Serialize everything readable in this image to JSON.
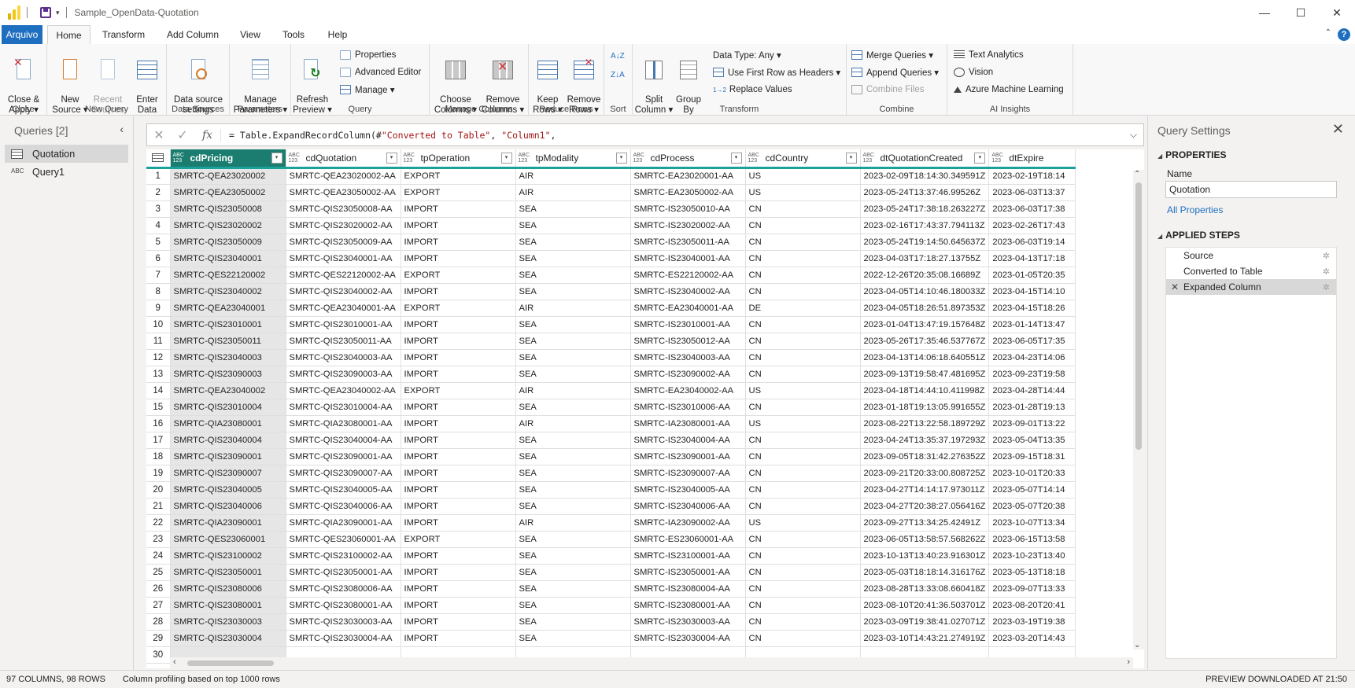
{
  "window": {
    "title": "Sample_OpenData-Quotation",
    "minimize": "—",
    "maximize": "☐",
    "close": "✕"
  },
  "tabs": [
    "Arquivo",
    "Home",
    "Transform",
    "Add Column",
    "View",
    "Tools",
    "Help"
  ],
  "help_glyph": "?",
  "ribbon": {
    "close_group": {
      "label": "Close",
      "close_apply": "Close &\nApply ▾"
    },
    "new_query_group": {
      "label": "New Query",
      "new_source": "New\nSource ▾",
      "recent_sources": "Recent\nSources ▾",
      "enter_data": "Enter\nData"
    },
    "data_sources_group": {
      "label": "Data Sources",
      "data_source_settings": "Data source\nsettings"
    },
    "parameters_group": {
      "label": "Parameters",
      "manage_parameters": "Manage\nParameters ▾"
    },
    "query_group": {
      "label": "Query",
      "refresh_preview": "Refresh\nPreview ▾",
      "properties": "Properties",
      "advanced_editor": "Advanced Editor",
      "manage": "Manage ▾"
    },
    "manage_columns_group": {
      "label": "Manage Columns",
      "choose_columns": "Choose\nColumns ▾",
      "remove_columns": "Remove\nColumns ▾"
    },
    "reduce_rows_group": {
      "label": "Reduce Rows",
      "keep_rows": "Keep\nRows ▾",
      "remove_rows": "Remove\nRows ▾"
    },
    "sort_group": {
      "label": "Sort",
      "az": "A↓Z",
      "za": "Z↓A"
    },
    "transform_group": {
      "label": "Transform",
      "split_column": "Split\nColumn ▾",
      "group_by": "Group\nBy",
      "data_type": "Data Type: Any ▾",
      "use_first_row": "Use First Row as Headers ▾",
      "replace_values": "Replace Values",
      "replace_prefix": "1→2"
    },
    "combine_group": {
      "label": "Combine",
      "merge_queries": "Merge Queries ▾",
      "append_queries": "Append Queries ▾",
      "combine_files": "Combine Files"
    },
    "ai_group": {
      "label": "AI Insights",
      "text_analytics": "Text Analytics",
      "vision": "Vision",
      "azure_ml": "Azure Machine Learning"
    }
  },
  "queries_pane": {
    "title": "Queries [2]",
    "collapse": "‹",
    "items": [
      {
        "label": "Quotation",
        "icon": "table-icon",
        "selected": true
      },
      {
        "label": "Query1",
        "icon": "abc-icon",
        "icon_glyph": "ABC",
        "selected": false
      }
    ]
  },
  "formula_bar": {
    "cancel": "✕",
    "commit": "✓",
    "fx": "fx",
    "prefix": "= Table.ExpandRecordColumn(#",
    "arg1": "\"Converted to Table\"",
    "sep": ", ",
    "arg2": "\"Column1\"",
    "suffix": ",",
    "expand": "⌵"
  },
  "grid": {
    "type_glyph": "ABC 123",
    "columns": [
      {
        "name": "cdPricing",
        "width": 147,
        "selected": true
      },
      {
        "name": "cdQuotation",
        "width": 146
      },
      {
        "name": "tpOperation",
        "width": 146
      },
      {
        "name": "tpModality",
        "width": 146
      },
      {
        "name": "cdProcess",
        "width": 146
      },
      {
        "name": "cdCountry",
        "width": 146
      },
      {
        "name": "dtQuotationCreated",
        "width": 155
      },
      {
        "name": "dtExpire",
        "width": 110
      }
    ],
    "rows": [
      [
        "1",
        "SMRTC-QEA23020002",
        "SMRTC-QEA23020002-AA",
        "EXPORT",
        "AIR",
        "SMRTC-EA23020001-AA",
        "US",
        "2023-02-09T18:14:30.349591Z",
        "2023-02-19T18:14"
      ],
      [
        "2",
        "SMRTC-QEA23050002",
        "SMRTC-QEA23050002-AA",
        "EXPORT",
        "AIR",
        "SMRTC-EA23050002-AA",
        "US",
        "2023-05-24T13:37:46.99526Z",
        "2023-06-03T13:37"
      ],
      [
        "3",
        "SMRTC-QIS23050008",
        "SMRTC-QIS23050008-AA",
        "IMPORT",
        "SEA",
        "SMRTC-IS23050010-AA",
        "CN",
        "2023-05-24T17:38:18.263227Z",
        "2023-06-03T17:38"
      ],
      [
        "4",
        "SMRTC-QIS23020002",
        "SMRTC-QIS23020002-AA",
        "IMPORT",
        "SEA",
        "SMRTC-IS23020002-AA",
        "CN",
        "2023-02-16T17:43:37.794113Z",
        "2023-02-26T17:43"
      ],
      [
        "5",
        "SMRTC-QIS23050009",
        "SMRTC-QIS23050009-AA",
        "IMPORT",
        "SEA",
        "SMRTC-IS23050011-AA",
        "CN",
        "2023-05-24T19:14:50.645637Z",
        "2023-06-03T19:14"
      ],
      [
        "6",
        "SMRTC-QIS23040001",
        "SMRTC-QIS23040001-AA",
        "IMPORT",
        "SEA",
        "SMRTC-IS23040001-AA",
        "CN",
        "2023-04-03T17:18:27.13755Z",
        "2023-04-13T17:18"
      ],
      [
        "7",
        "SMRTC-QES22120002",
        "SMRTC-QES22120002-AA",
        "EXPORT",
        "SEA",
        "SMRTC-ES22120002-AA",
        "CN",
        "2022-12-26T20:35:08.16689Z",
        "2023-01-05T20:35"
      ],
      [
        "8",
        "SMRTC-QIS23040002",
        "SMRTC-QIS23040002-AA",
        "IMPORT",
        "SEA",
        "SMRTC-IS23040002-AA",
        "CN",
        "2023-04-05T14:10:46.180033Z",
        "2023-04-15T14:10"
      ],
      [
        "9",
        "SMRTC-QEA23040001",
        "SMRTC-QEA23040001-AA",
        "EXPORT",
        "AIR",
        "SMRTC-EA23040001-AA",
        "DE",
        "2023-04-05T18:26:51.897353Z",
        "2023-04-15T18:26"
      ],
      [
        "10",
        "SMRTC-QIS23010001",
        "SMRTC-QIS23010001-AA",
        "IMPORT",
        "SEA",
        "SMRTC-IS23010001-AA",
        "CN",
        "2023-01-04T13:47:19.157648Z",
        "2023-01-14T13:47"
      ],
      [
        "11",
        "SMRTC-QIS23050011",
        "SMRTC-QIS23050011-AA",
        "IMPORT",
        "SEA",
        "SMRTC-IS23050012-AA",
        "CN",
        "2023-05-26T17:35:46.537767Z",
        "2023-06-05T17:35"
      ],
      [
        "12",
        "SMRTC-QIS23040003",
        "SMRTC-QIS23040003-AA",
        "IMPORT",
        "SEA",
        "SMRTC-IS23040003-AA",
        "CN",
        "2023-04-13T14:06:18.640551Z",
        "2023-04-23T14:06"
      ],
      [
        "13",
        "SMRTC-QIS23090003",
        "SMRTC-QIS23090003-AA",
        "IMPORT",
        "SEA",
        "SMRTC-IS23090002-AA",
        "CN",
        "2023-09-13T19:58:47.481695Z",
        "2023-09-23T19:58"
      ],
      [
        "14",
        "SMRTC-QEA23040002",
        "SMRTC-QEA23040002-AA",
        "EXPORT",
        "AIR",
        "SMRTC-EA23040002-AA",
        "US",
        "2023-04-18T14:44:10.411998Z",
        "2023-04-28T14:44"
      ],
      [
        "15",
        "SMRTC-QIS23010004",
        "SMRTC-QIS23010004-AA",
        "IMPORT",
        "SEA",
        "SMRTC-IS23010006-AA",
        "CN",
        "2023-01-18T19:13:05.991655Z",
        "2023-01-28T19:13"
      ],
      [
        "16",
        "SMRTC-QIA23080001",
        "SMRTC-QIA23080001-AA",
        "IMPORT",
        "AIR",
        "SMRTC-IA23080001-AA",
        "US",
        "2023-08-22T13:22:58.189729Z",
        "2023-09-01T13:22"
      ],
      [
        "17",
        "SMRTC-QIS23040004",
        "SMRTC-QIS23040004-AA",
        "IMPORT",
        "SEA",
        "SMRTC-IS23040004-AA",
        "CN",
        "2023-04-24T13:35:37.197293Z",
        "2023-05-04T13:35"
      ],
      [
        "18",
        "SMRTC-QIS23090001",
        "SMRTC-QIS23090001-AA",
        "IMPORT",
        "SEA",
        "SMRTC-IS23090001-AA",
        "CN",
        "2023-09-05T18:31:42.276352Z",
        "2023-09-15T18:31"
      ],
      [
        "19",
        "SMRTC-QIS23090007",
        "SMRTC-QIS23090007-AA",
        "IMPORT",
        "SEA",
        "SMRTC-IS23090007-AA",
        "CN",
        "2023-09-21T20:33:00.808725Z",
        "2023-10-01T20:33"
      ],
      [
        "20",
        "SMRTC-QIS23040005",
        "SMRTC-QIS23040005-AA",
        "IMPORT",
        "SEA",
        "SMRTC-IS23040005-AA",
        "CN",
        "2023-04-27T14:14:17.973011Z",
        "2023-05-07T14:14"
      ],
      [
        "21",
        "SMRTC-QIS23040006",
        "SMRTC-QIS23040006-AA",
        "IMPORT",
        "SEA",
        "SMRTC-IS23040006-AA",
        "CN",
        "2023-04-27T20:38:27.056416Z",
        "2023-05-07T20:38"
      ],
      [
        "22",
        "SMRTC-QIA23090001",
        "SMRTC-QIA23090001-AA",
        "IMPORT",
        "AIR",
        "SMRTC-IA23090002-AA",
        "US",
        "2023-09-27T13:34:25.42491Z",
        "2023-10-07T13:34"
      ],
      [
        "23",
        "SMRTC-QES23060001",
        "SMRTC-QES23060001-AA",
        "EXPORT",
        "SEA",
        "SMRTC-ES23060001-AA",
        "CN",
        "2023-06-05T13:58:57.568262Z",
        "2023-06-15T13:58"
      ],
      [
        "24",
        "SMRTC-QIS23100002",
        "SMRTC-QIS23100002-AA",
        "IMPORT",
        "SEA",
        "SMRTC-IS23100001-AA",
        "CN",
        "2023-10-13T13:40:23.916301Z",
        "2023-10-23T13:40"
      ],
      [
        "25",
        "SMRTC-QIS23050001",
        "SMRTC-QIS23050001-AA",
        "IMPORT",
        "SEA",
        "SMRTC-IS23050001-AA",
        "CN",
        "2023-05-03T18:18:14.316176Z",
        "2023-05-13T18:18"
      ],
      [
        "26",
        "SMRTC-QIS23080006",
        "SMRTC-QIS23080006-AA",
        "IMPORT",
        "SEA",
        "SMRTC-IS23080004-AA",
        "CN",
        "2023-08-28T13:33:08.660418Z",
        "2023-09-07T13:33"
      ],
      [
        "27",
        "SMRTC-QIS23080001",
        "SMRTC-QIS23080001-AA",
        "IMPORT",
        "SEA",
        "SMRTC-IS23080001-AA",
        "CN",
        "2023-08-10T20:41:36.503701Z",
        "2023-08-20T20:41"
      ],
      [
        "28",
        "SMRTC-QIS23030003",
        "SMRTC-QIS23030003-AA",
        "IMPORT",
        "SEA",
        "SMRTC-IS23030003-AA",
        "CN",
        "2023-03-09T19:38:41.027071Z",
        "2023-03-19T19:38"
      ],
      [
        "29",
        "SMRTC-QIS23030004",
        "SMRTC-QIS23030004-AA",
        "IMPORT",
        "SEA",
        "SMRTC-IS23030004-AA",
        "CN",
        "2023-03-10T14:43:21.274919Z",
        "2023-03-20T14:43"
      ],
      [
        "30",
        "",
        "",
        "",
        "",
        "",
        "",
        "",
        ""
      ]
    ]
  },
  "query_settings": {
    "title": "Query Settings",
    "close": "✕",
    "properties_header": "PROPERTIES",
    "name_label": "Name",
    "name_value": "Quotation",
    "all_properties": "All Properties",
    "applied_steps_header": "APPLIED STEPS",
    "steps": [
      {
        "label": "Source",
        "active": false
      },
      {
        "label": "Converted to Table",
        "active": false
      },
      {
        "label": "Expanded Column",
        "active": true
      }
    ]
  },
  "status": {
    "left1": "97 COLUMNS, 98 ROWS",
    "left2": "Column profiling based on top 1000 rows",
    "right": "PREVIEW DOWNLOADED AT 21:50"
  },
  "colors": {
    "accent": "#1f6fc0",
    "selected_header": "#1b7d6f",
    "header_rule": "#1aa19b"
  }
}
